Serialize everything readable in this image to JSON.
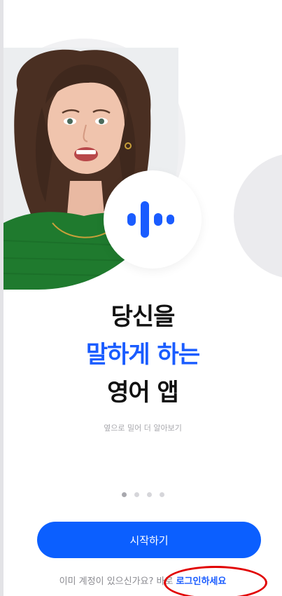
{
  "onboarding": {
    "headline_line1": "당신을",
    "headline_line2": "말하게 하는",
    "headline_line3": "영어 앱",
    "swipe_hint": "옆으로 밀어 더 알아보기",
    "page_indicator": {
      "total": 4,
      "active": 1
    },
    "start_button_label": "시작하기",
    "login_prompt": "이미 계정이 있으신가요?",
    "login_prefix": "바로",
    "login_link_label": "로그인하세요"
  },
  "icons": {
    "voice": "voice-waveform-icon"
  },
  "colors": {
    "accent": "#0b5fff",
    "highlight_text": "#1a5cff",
    "annotation": "#e10000",
    "shirt": "#1f7a2e"
  }
}
